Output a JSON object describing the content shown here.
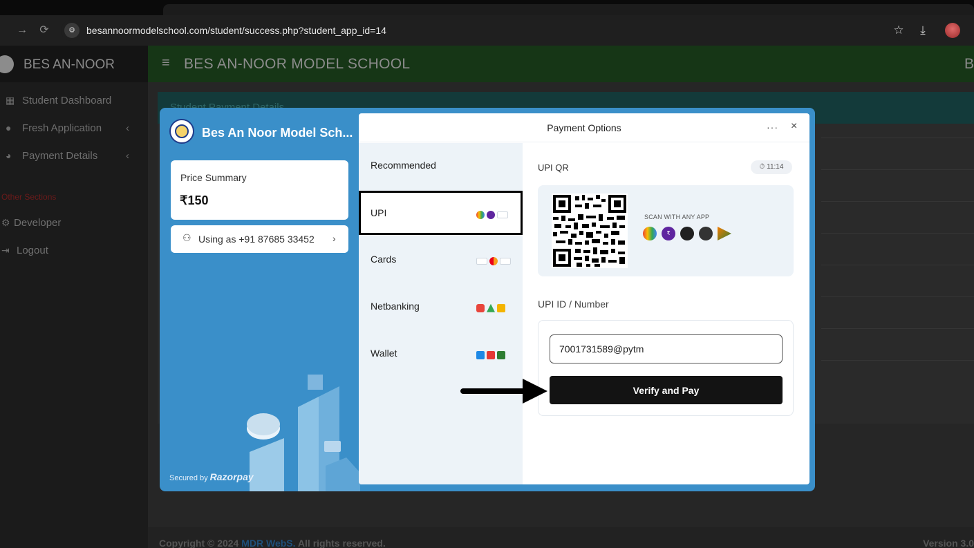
{
  "browser": {
    "url": "besannoormodelschool.com/student/success.php?student_app_id=14",
    "back_icon": "arrow-right-icon",
    "reload_icon": "reload-icon",
    "bookmark_icon": "star-icon",
    "download_icon": "download-icon"
  },
  "app": {
    "brand": "BES AN-NOOR",
    "title": "BES AN-NOOR MODEL SCHOOL",
    "topbar_right": "B",
    "sidebar": {
      "items": [
        {
          "label": "Student Dashboard",
          "icon": "table-icon"
        },
        {
          "label": "Fresh Application",
          "icon": "help-icon"
        },
        {
          "label": "Payment Details",
          "icon": "chart-icon"
        }
      ],
      "section": "Other Sections",
      "other_items": [
        {
          "label": "Developer",
          "icon": "gear-icon"
        },
        {
          "label": "Logout",
          "icon": "logout-icon"
        }
      ]
    },
    "card_header": "Student Payment Details",
    "footer": {
      "copyright_prefix": "Copyright © 2024 ",
      "company": "MDR WebS.",
      "copyright_suffix": " All rights reserved.",
      "version": "Version 3.0"
    }
  },
  "checkout": {
    "merchant": "Bes An Noor Model Sch...",
    "price_summary_label": "Price Summary",
    "amount": "₹150",
    "using_as": "Using as +91 87685 33452",
    "secured_by": "Secured by",
    "razorpay": "Razorpay",
    "header_title": "Payment Options",
    "more": "···",
    "close": "×",
    "methods": [
      {
        "label": "Recommended"
      },
      {
        "label": "UPI",
        "selected": true
      },
      {
        "label": "Cards"
      },
      {
        "label": "Netbanking"
      },
      {
        "label": "Wallet"
      }
    ],
    "upi_qr_label": "UPI QR",
    "timer": "11:14",
    "scan_text": "SCAN WITH ANY APP",
    "upi_id_label": "UPI ID / Number",
    "upi_id_value": "7001731589@pytm",
    "verify_button": "Verify and Pay"
  },
  "colors": {
    "modal_blue": "#3a8fc9",
    "button_black": "#131313",
    "selected_border": "#000000"
  }
}
